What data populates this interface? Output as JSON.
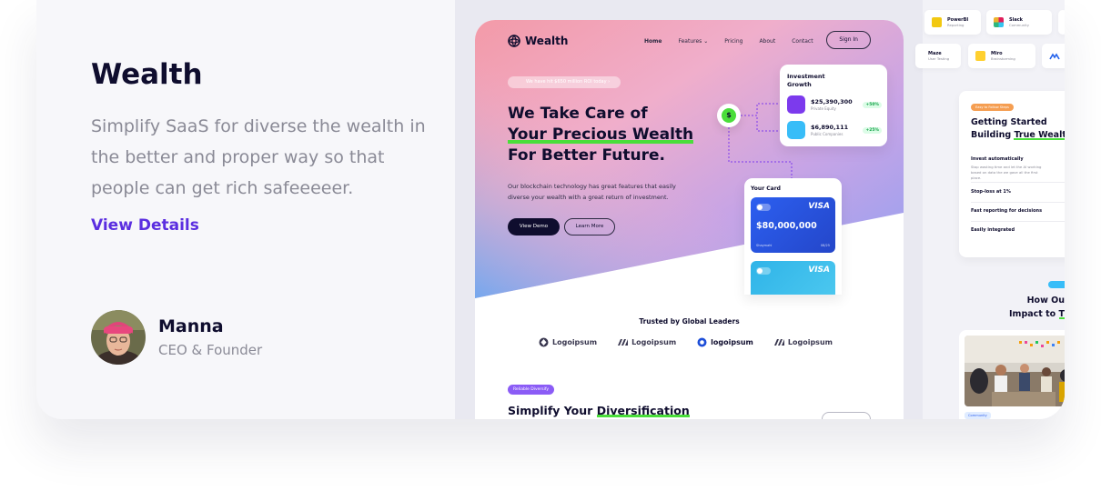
{
  "card": {
    "title": "Wealth",
    "description": "Simplify SaaS for diverse the wealth in the better and proper way so that people can get rich safeeeeer.",
    "link_label": "View Details",
    "author": {
      "name": "Manna",
      "role": "CEO & Founder"
    }
  },
  "colors": {
    "accent": "#5b2ee0",
    "heading": "#0f0d2e",
    "muted": "#8a8a96",
    "highlight": "#4ade3a",
    "visa_blue": "#2c5ff0",
    "visa_cyan": "#2fb4e8"
  },
  "preview": {
    "nav": {
      "brand": "Wealth",
      "links": [
        "Home",
        "Features",
        "Pricing",
        "About",
        "Contact"
      ],
      "sign_in": "Sign In"
    },
    "hero": {
      "pill": "We have hit $650 million ROI today",
      "headline_1": "We Take Care of",
      "headline_2": "Your Precious Wealth",
      "headline_3": "For Better Future.",
      "paragraph": "Our blockchain technology has great features that easily diverse your wealth with a great return of investment.",
      "btn_demo": "View Demo",
      "btn_learn": "Learn More"
    },
    "investment": {
      "title": "Investment Growth",
      "rows": [
        {
          "amount": "$25,390,300",
          "label": "Private Equity",
          "pct": "+50%"
        },
        {
          "amount": "$6,890,111",
          "label": "Public Companies",
          "pct": "+25%"
        }
      ]
    },
    "your_card": {
      "title": "Your Card",
      "brand": "VISA",
      "amount": "$80,000,000",
      "holder": "Shaymahl",
      "expiry": "08/25"
    },
    "trusted": {
      "title": "Trusted by Global Leaders",
      "logos": [
        "Logoipsum",
        "Logoipsum",
        "logoipsum",
        "Logoipsum"
      ]
    },
    "diversify": {
      "tag": "Reliable Diversify",
      "title_1": "Simplify Your ",
      "title_2": "Diversification"
    },
    "side": {
      "chips": [
        {
          "name": "PowerBI",
          "sub": "Reporting"
        },
        {
          "name": "Slack",
          "sub": "Community"
        },
        {
          "name": "Maze",
          "sub": "User Testing"
        },
        {
          "name": "Miro",
          "sub": "Brainstorming"
        }
      ],
      "gs_tag": "Easy to Follow Steps",
      "gs_title_1": "Getting Started Building ",
      "gs_title_2": "True Wealth",
      "accordion": [
        {
          "label": "Invest automatically",
          "sub": "Stop wasting time and let the AI working based on data the we gave all the first place."
        },
        {
          "label": "Stop-loss at 1%",
          "sub": ""
        },
        {
          "label": "Fast reporting for decisions",
          "sub": ""
        },
        {
          "label": "Easily integrated",
          "sub": ""
        }
      ],
      "impact_1": "How Ou",
      "impact_2": "Impact to ",
      "impact_3": "T",
      "community_tag": "Community"
    }
  }
}
